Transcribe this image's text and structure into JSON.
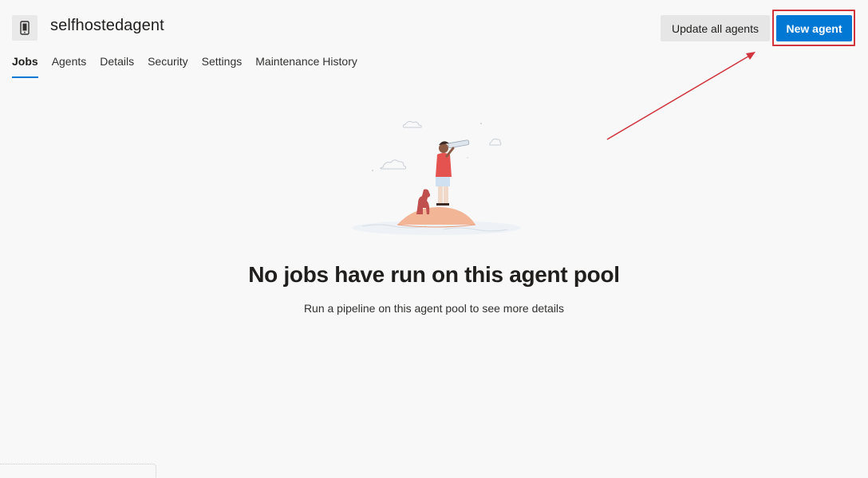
{
  "header": {
    "icon": "agent-pool-icon",
    "title": "selfhostedagent",
    "buttons": {
      "update_all_label": "Update all agents",
      "new_agent_label": "New agent"
    }
  },
  "tabs": [
    {
      "label": "Jobs",
      "active": true
    },
    {
      "label": "Agents",
      "active": false
    },
    {
      "label": "Details",
      "active": false
    },
    {
      "label": "Security",
      "active": false
    },
    {
      "label": "Settings",
      "active": false
    },
    {
      "label": "Maintenance History",
      "active": false
    }
  ],
  "empty_state": {
    "illustration": "person-on-island-illustration",
    "title": "No jobs have run on this agent pool",
    "description": "Run a pipeline on this agent pool to see more details"
  },
  "colors": {
    "primary": "#0078d4",
    "annotation": "#d1343d"
  }
}
